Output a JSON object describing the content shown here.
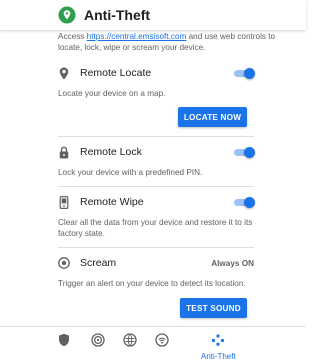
{
  "app_bar": {
    "title": "Anti-Theft",
    "logo_icon": "emsisoft-shield-logo-icon"
  },
  "intro": {
    "prefix": "Access ",
    "link": "https://central.emsisoft.com",
    "suffix": " and use web controls to locate, lock, wipe or scream your device."
  },
  "features": {
    "remote_locate": {
      "title": "Remote Locate",
      "description": "Locate your device on a map.",
      "enabled": true,
      "button_label": "LOCATE NOW",
      "icon": "map-pin-icon"
    },
    "remote_lock": {
      "title": "Remote Lock",
      "description": "Lock your device with a predefined PIN.",
      "enabled": true,
      "icon": "lock-icon"
    },
    "remote_wipe": {
      "title": "Remote Wipe",
      "description": "Clear all the data from your device and restore it to its factory state.",
      "enabled": true,
      "icon": "wipe-device-icon"
    },
    "scream": {
      "title": "Scream",
      "status": "Always ON",
      "description": "Trigger an alert on your device to detect its location.",
      "button_label": "TEST SOUND",
      "icon": "speaker-icon"
    }
  },
  "bottom_nav": {
    "items": [
      {
        "icon": "shield-icon",
        "label": ""
      },
      {
        "icon": "fingerprint-icon",
        "label": ""
      },
      {
        "icon": "globe-icon",
        "label": ""
      },
      {
        "icon": "wifi-shield-icon",
        "label": ""
      },
      {
        "icon": "anti-theft-icon",
        "label": "Anti-Theft"
      }
    ]
  },
  "colors": {
    "accent": "#1a73e8",
    "toggle_track": "#9cc2f5",
    "logo_green": "#2e9e4f",
    "text_primary": "#212121",
    "text_secondary": "#616161",
    "icon_grey": "#616161"
  }
}
